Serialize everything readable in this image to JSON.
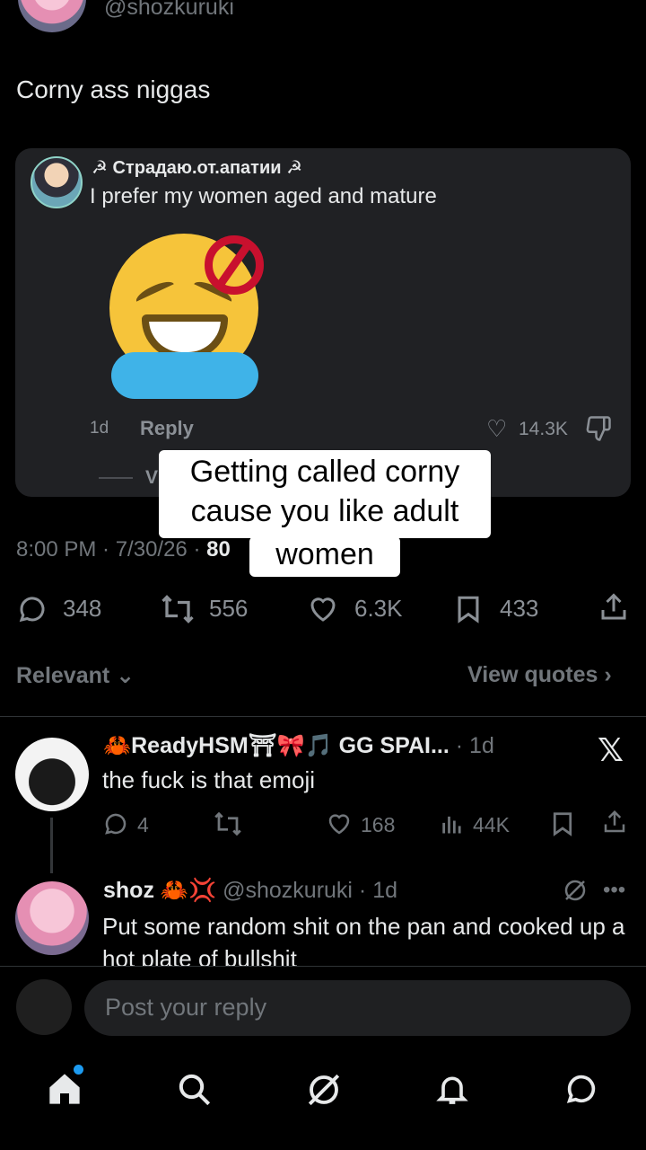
{
  "post": {
    "handle": "@shozkuruki",
    "text": "Corny ass niggas",
    "meta_time": "8:00 PM · 7/30/26 · ",
    "meta_views_partial": "80"
  },
  "quoted": {
    "author_name": "☭ Страдаю.от.апатии ☭",
    "text": "I prefer my women aged and mature",
    "age": "1d",
    "reply_label": "Reply",
    "likes": "14.3K",
    "view_partial": "V"
  },
  "caption": {
    "line1": "Getting called corny",
    "line2": "cause you like adult",
    "line3": "women"
  },
  "actions": {
    "replies": "348",
    "reposts": "556",
    "likes": "6.3K",
    "bookmarks": "433"
  },
  "sort": {
    "relevant_label": "Relevant ⌄",
    "view_quotes_label": "View quotes ›"
  },
  "replies": [
    {
      "name": "🦀ReadyHSM⛩🎀🎵 GG SPAI...",
      "age": " · 1d",
      "text": "the fuck is that emoji",
      "replies": "4",
      "likes": "168",
      "views": "44K"
    },
    {
      "name": "shoz",
      "badges": " 🦀💢 ",
      "handle": "@shozkuruki · 1d",
      "text": "Put some random shit on the pan and cooked up a hot plate of bullshit"
    }
  ],
  "composer": {
    "placeholder": "Post your reply"
  },
  "icons": {
    "reply": "comment-icon",
    "repost": "repost-icon",
    "like": "heart-icon",
    "bookmark": "bookmark-icon",
    "share": "share-icon",
    "grok": "grok-icon",
    "home": "home-icon",
    "search": "search-icon",
    "notifications": "bell-icon",
    "messages": "message-icon"
  },
  "colors": {
    "background": "#000000",
    "card": "#202124",
    "muted": "#71767b",
    "accent": "#1d9bf0"
  }
}
